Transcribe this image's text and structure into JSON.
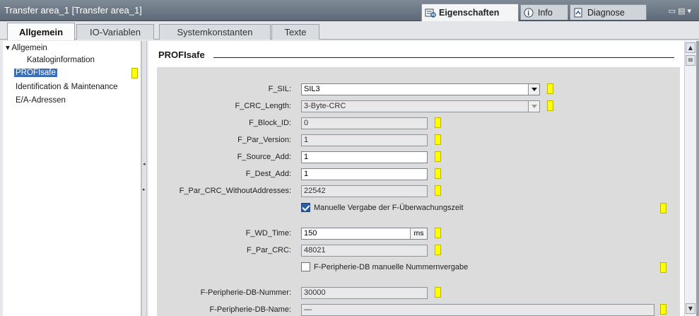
{
  "window": {
    "title": "Transfer area_1 [Transfer area_1]",
    "tabs": [
      {
        "label": "Eigenschaften",
        "icon": "properties-icon"
      },
      {
        "label": "Info",
        "icon": "info-icon"
      },
      {
        "label": "Diagnose",
        "icon": "diagnostics-icon"
      }
    ]
  },
  "tabs": [
    "Allgemein",
    "IO-Variablen",
    "Systemkonstanten",
    "Texte"
  ],
  "tree": [
    {
      "label": "▾ Allgemein"
    },
    {
      "label": "Kataloginformation"
    },
    {
      "label": "PROFIsafe"
    },
    {
      "label": "Identification & Maintenance"
    },
    {
      "label": "E/A-Adressen"
    }
  ],
  "section": {
    "title": "PROFIsafe"
  },
  "fields": {
    "f_sil": {
      "label": "F_SIL:",
      "value": "SIL3"
    },
    "f_crc_length": {
      "label": "F_CRC_Length:",
      "value": "3-Byte-CRC"
    },
    "f_block_id": {
      "label": "F_Block_ID:",
      "value": "0"
    },
    "f_par_version": {
      "label": "F_Par_Version:",
      "value": "1"
    },
    "f_source_add": {
      "label": "F_Source_Add:",
      "value": "1"
    },
    "f_dest_add": {
      "label": "F_Dest_Add:",
      "value": "1"
    },
    "f_par_crc_without": {
      "label": "F_Par_CRC_WithoutAddresses:",
      "value": "22542"
    },
    "manual_wd": {
      "label": "Manuelle Vergabe der F-Überwachungszeit",
      "checked": true
    },
    "f_wd_time": {
      "label": "F_WD_Time:",
      "value": "150",
      "unit": "ms"
    },
    "f_par_crc": {
      "label": "F_Par_CRC:",
      "value": "48021"
    },
    "manual_db": {
      "label": "F-Peripherie-DB manuelle Nummernvergabe",
      "checked": false
    },
    "db_number": {
      "label": "F-Peripherie-DB-Nummer:",
      "value": "30000"
    },
    "db_name": {
      "label": "F-Peripherie-DB-Name:",
      "value": "—"
    }
  },
  "colors": {
    "marker": "#ffff00",
    "selection": "#3a6fb8"
  }
}
